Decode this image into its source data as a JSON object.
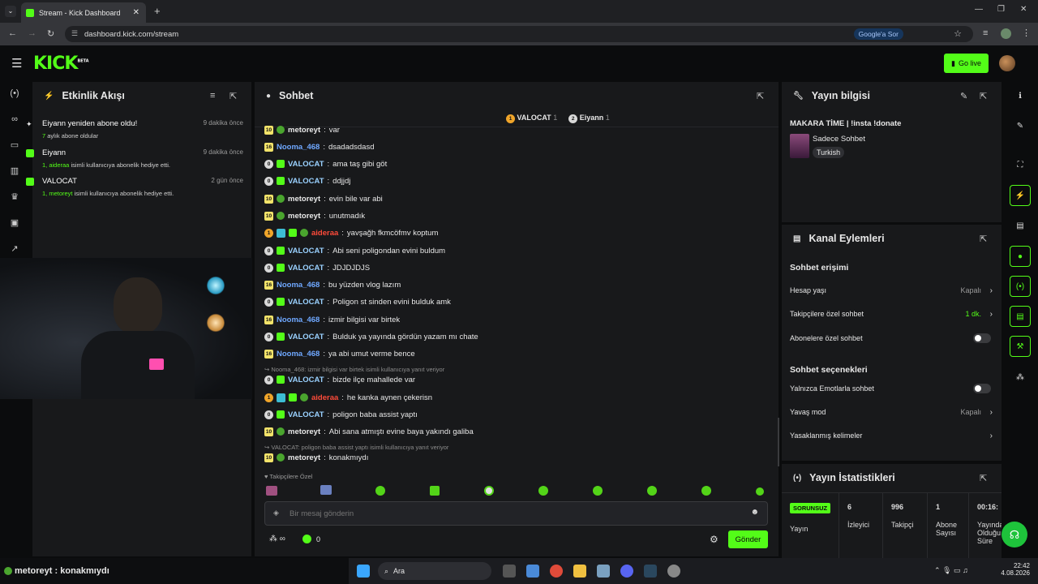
{
  "browser": {
    "tab_title": "Stream - Kick Dashboard",
    "url": "dashboard.kick.com/stream",
    "google_sor": "Google'a Sor"
  },
  "header": {
    "logo": "KICK",
    "beta": "BETA",
    "go_live": "Go live"
  },
  "activity": {
    "title": "Etkinlik Akışı",
    "items": [
      {
        "title": "Eiyann yeniden abone oldu!",
        "time": "9 dakika önce",
        "sub_a": "7",
        "sub_b": "aylık abone oldular"
      },
      {
        "title": "Eiyann",
        "time": "9 dakika önce",
        "sub_a": "1, aideraa",
        "sub_b": "isimli kullanıcıya abonelik hediye etti."
      },
      {
        "title": "VALOCAT",
        "time": "2 gün önce",
        "sub_a": "1, metoreyt",
        "sub_b": "isimli kullanıcıya abonelik hediye etti."
      }
    ]
  },
  "chat": {
    "title": "Sohbet",
    "top": [
      {
        "name": "VALOCAT",
        "count": "1",
        "rank": "1"
      },
      {
        "name": "Eiyann",
        "count": "1",
        "rank": "2"
      }
    ],
    "messages": [
      {
        "badge": "10",
        "user": "metoreyt",
        "text": "var"
      },
      {
        "badge": "16",
        "user": "Nooma_468",
        "text": "dsadadsdasd"
      },
      {
        "badge": "0",
        "user": "VALOCAT",
        "text": "ama taş gibi göt"
      },
      {
        "badge": "0",
        "user": "VALOCAT",
        "text": "ddjjdj"
      },
      {
        "badge": "10",
        "user": "metoreyt",
        "text": "evin bile var abi"
      },
      {
        "badge": "10",
        "user": "metoreyt",
        "text": "unutmadık"
      },
      {
        "badge": "1",
        "user": "aideraa",
        "text": "yavşağh fkmcöfmv koptum"
      },
      {
        "badge": "0",
        "user": "VALOCAT",
        "text": "Abi seni poligondan evini buldum"
      },
      {
        "badge": "0",
        "user": "VALOCAT",
        "text": "JDJDJDJS"
      },
      {
        "badge": "16",
        "user": "Nooma_468",
        "text": "bu yüzden vlog lazım"
      },
      {
        "badge": "0",
        "user": "VALOCAT",
        "text": "Poligon st sinden evini bulduk amk"
      },
      {
        "badge": "16",
        "user": "Nooma_468",
        "text": "izmir bilgisi var birtek"
      },
      {
        "badge": "0",
        "user": "VALOCAT",
        "text": "Bulduk ya yayında gördün yazam mı chate"
      },
      {
        "badge": "16",
        "user": "Nooma_468",
        "text": "ya abi umut verme bence"
      },
      {
        "badge": "0",
        "user": "VALOCAT",
        "text": "bizde ilçe mahallede var"
      },
      {
        "badge": "1",
        "user": "aideraa",
        "text": "he kanka aynen çekerisn"
      },
      {
        "badge": "0",
        "user": "VALOCAT",
        "text": "poligon baba assist yaptı"
      },
      {
        "badge": "10",
        "user": "metoreyt",
        "text": "Abi sana atmıştı evine baya yakındı galiba"
      },
      {
        "badge": "10",
        "user": "metoreyt",
        "text": "konakmıydı"
      }
    ],
    "reply1": "Nooma_468: izmir bilgisi var birtek isimli kullanıcıya yanıt veriyor",
    "reply2": "VALOCAT: poligon baba assist yaptı isimli kullanıcıya yanıt veriyor",
    "followers_only": "Takipçilere Özel",
    "placeholder": "Bir mesaj gönderin",
    "points": "0",
    "send": "Gönder"
  },
  "stream_info": {
    "title": "Yayın bilgisi",
    "stream_title": "MAKARA TİME | !insta !donate",
    "category": "Sadece Sohbet",
    "tag": "Turkish"
  },
  "channel_actions": {
    "title": "Kanal Eylemleri",
    "section1": "Sohbet erişimi",
    "account_age": "Hesap yaşı",
    "account_age_val": "Kapalı",
    "followers_chat": "Takipçilere özel sohbet",
    "followers_chat_val": "1 dk.",
    "subs_chat": "Abonelere özel sohbet",
    "section2": "Sohbet seçenekleri",
    "emote_only": "Yalnızca Emotlarla sohbet",
    "slow_mode": "Yavaş mod",
    "slow_mode_val": "Kapalı",
    "banned_words": "Yasaklanmış kelimeler"
  },
  "stats": {
    "title": "Yayın İstatistikleri",
    "status": "SORUNSUZ",
    "status_label": "Yayın",
    "viewers": "6",
    "viewers_label": "İzleyici",
    "followers": "996",
    "followers_label": "Takipçi",
    "subs": "1",
    "subs_label1": "Abone",
    "subs_label2": "Sayısı",
    "time": "00:16:",
    "time_label1": "Yayında",
    "time_label2": "Olduğu",
    "time_label3": "Süre"
  },
  "overlay_caption": "metoreyt : konakmıydı",
  "taskbar": {
    "search": "Ara",
    "time": "22:42",
    "date": "4.08.2026"
  },
  "colors": {
    "accent": "#53fc18",
    "panel": "#18191b"
  }
}
